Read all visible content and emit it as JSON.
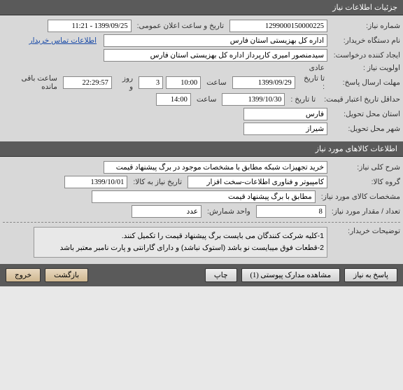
{
  "sections": {
    "need_info": "جزئیات اطلاعات نیاز",
    "goods_info": "اطلاعات کالاهای مورد نیاز"
  },
  "labels": {
    "need_no": "شماره نیاز:",
    "public_date": "تاریخ و ساعت اعلان عمومی:",
    "buyer_org": "نام دستگاه خریدار:",
    "creator": "ایجاد کننده درخواست:",
    "priority": "اولویت نیاز :",
    "deadline": "مهلت ارسال پاسخ:",
    "to_date": "تا تاریخ :",
    "hour": "ساعت",
    "days_and": "روز و",
    "remaining": "ساعت باقی مانده",
    "min_valid": "حداقل تاریخ اعتبار قیمت:",
    "delivery_prov": "استان محل تحویل:",
    "delivery_city": "شهر محل تحویل:",
    "need_desc": "شرح کلی نیاز:",
    "goods_group": "گروه کالا:",
    "goods_date": "تاریخ نیاز به کالا:",
    "goods_spec": "مشخصات کالای مورد نیاز:",
    "qty": "تعداد / مقدار مورد نیاز:",
    "unit": "واحد شمارش:",
    "buyer_notes": "توضیحات خریدار:",
    "contact_link": "اطلاعات تماس خریدار"
  },
  "values": {
    "need_no": "1299000150000225",
    "public_date": "1399/09/25 - 11:21",
    "buyer_org": "اداره کل بهزیستی استان فارس",
    "creator": "سیدمنصور امیری کارپرداز اداره کل بهزیستی استان فارس",
    "priority": "عادی",
    "deadline_date": "1399/09/29",
    "deadline_time": "10:00",
    "remaining_days": "3",
    "remaining_time": "22:29:57",
    "min_valid_date": "1399/10/30",
    "min_valid_time": "14:00",
    "delivery_prov": "فارس",
    "delivery_city": "شیراز",
    "need_desc": "خرید تجهیزات شبکه مطابق با مشخصات موجود در برگ پیشنهاد قیمت",
    "goods_group": "کامپیوتر و فناوری اطلاعات-سخت افزار",
    "goods_date": "1399/10/01",
    "goods_spec": "مطابق با برگ پیشنهاد قیمت",
    "qty": "8",
    "unit": "عدد",
    "notes_line1": "1-کلیه شرکت کنندگان می بایست برگ پیشنهاد قیمت را تکمیل کنند.",
    "notes_line2": "2-قطعات فوق میبایست نو باشد (استوک نباشد) و دارای گارانتی و پارت نامبر معتبر باشد"
  },
  "buttons": {
    "respond": "پاسخ به نیاز",
    "attachments": "مشاهده مدارک پیوستی  (1)",
    "print": "چاپ",
    "back": "بازگشت",
    "exit": "خروج"
  }
}
